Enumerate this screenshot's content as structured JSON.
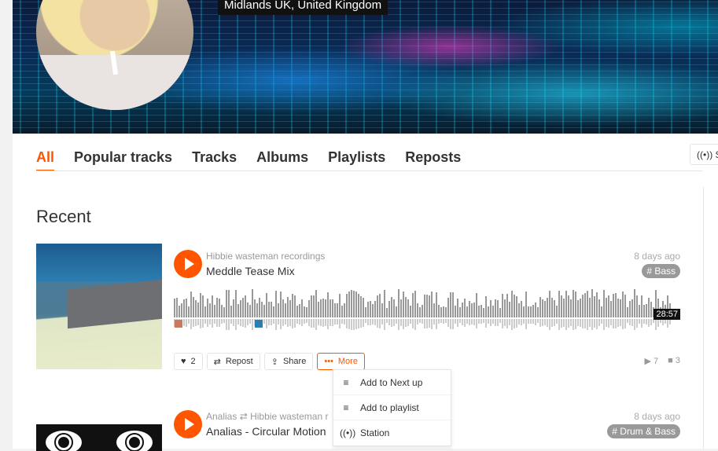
{
  "profile": {
    "location": "Midlands UK, United Kingdom"
  },
  "tabs": [
    {
      "label": "All"
    },
    {
      "label": "Popular tracks"
    },
    {
      "label": "Tracks"
    },
    {
      "label": "Albums"
    },
    {
      "label": "Playlists"
    },
    {
      "label": "Reposts"
    }
  ],
  "station_button": {
    "label": "S"
  },
  "section_title": "Recent",
  "tracks": [
    {
      "uploader": "Hibbie wasteman recordings",
      "title": "Meddle Tease Mix",
      "date": "8 days ago",
      "tag": "# Bass",
      "duration": "28:57",
      "likes": "2",
      "repost_label": "Repost",
      "share_label": "Share",
      "more_label": "More",
      "plays": "7",
      "comments": "3"
    },
    {
      "uploader": "Analias",
      "reposter": "Hibbie wasteman r",
      "title": "Analias - Circular Motion",
      "date": "8 days ago",
      "tag": "# Drum & Bass"
    }
  ],
  "more_menu": [
    {
      "label": "Add to Next up",
      "icon": "add-to-next-up-icon"
    },
    {
      "label": "Add to playlist",
      "icon": "add-to-playlist-icon"
    },
    {
      "label": "Station",
      "icon": "station-icon"
    }
  ],
  "colors": {
    "accent": "#ff5500",
    "muted": "#999999",
    "tag_bg": "#999999"
  }
}
